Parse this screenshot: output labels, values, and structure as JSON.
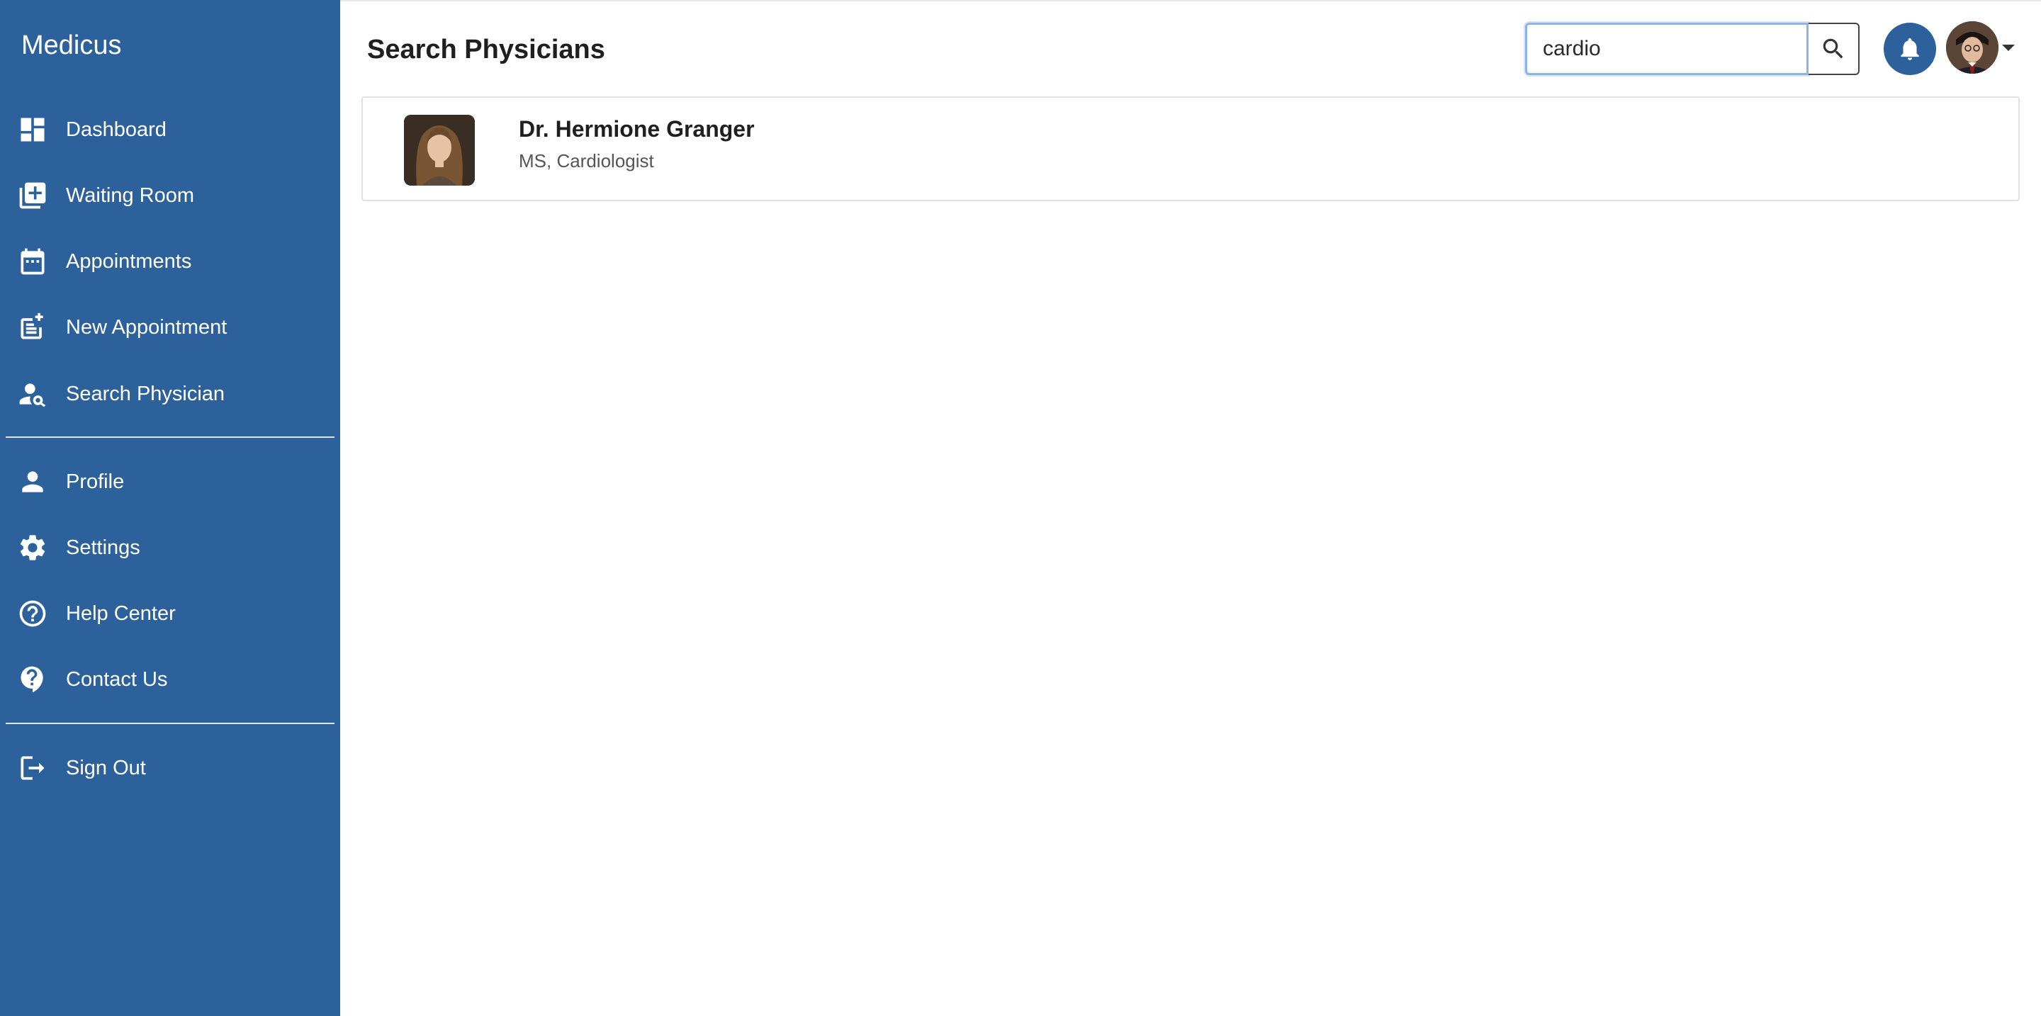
{
  "app": {
    "brand": "Medicus"
  },
  "sidebar": {
    "items": [
      {
        "label": "Dashboard",
        "icon": "dashboard-icon"
      },
      {
        "label": "Waiting Room",
        "icon": "queue-add-icon"
      },
      {
        "label": "Appointments",
        "icon": "calendar-icon"
      },
      {
        "label": "New Appointment",
        "icon": "note-add-icon"
      },
      {
        "label": "Search Physician",
        "icon": "person-search-icon"
      }
    ],
    "secondary": [
      {
        "label": "Profile",
        "icon": "person-icon"
      },
      {
        "label": "Settings",
        "icon": "gear-icon"
      },
      {
        "label": "Help Center",
        "icon": "help-circle-icon"
      },
      {
        "label": "Contact Us",
        "icon": "help-bubble-icon"
      }
    ],
    "signout": {
      "label": "Sign Out",
      "icon": "logout-icon"
    }
  },
  "header": {
    "title": "Search Physicians",
    "search": {
      "value": "cardio"
    }
  },
  "results": [
    {
      "name": "Dr. Hermione Granger",
      "specialty": "MS, Cardiologist"
    }
  ],
  "colors": {
    "sidebar_bg": "#2d619c",
    "accent": "#2d619c"
  }
}
